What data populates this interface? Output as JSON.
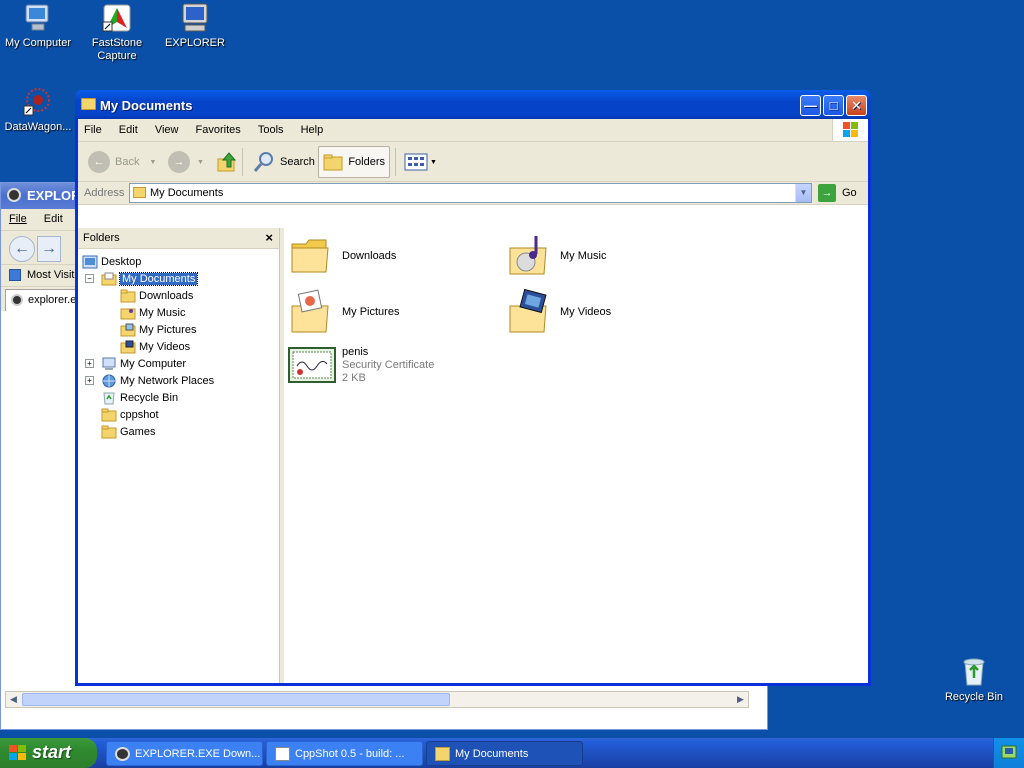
{
  "desktop": {
    "icons": [
      {
        "label": "My Computer"
      },
      {
        "label": "FastStone Capture"
      },
      {
        "label": "EXPLORER"
      },
      {
        "label": "DataWagon..."
      },
      {
        "label": "Recycle Bin"
      }
    ]
  },
  "ie_window": {
    "title": "EXPLORER",
    "menu": [
      "File",
      "Edit"
    ],
    "links_label": "Most Visite",
    "tab_label": "explorer.e"
  },
  "explorer": {
    "title": "My Documents",
    "menu": [
      "File",
      "Edit",
      "View",
      "Favorites",
      "Tools",
      "Help"
    ],
    "toolbar": {
      "back": "Back",
      "search": "Search",
      "folders": "Folders"
    },
    "address_label": "Address",
    "address_value": "My Documents",
    "go_label": "Go",
    "folders_pane": {
      "header": "Folders",
      "close": "×",
      "tree": [
        {
          "label": "Desktop"
        },
        {
          "label": "My Documents",
          "expander": "−"
        },
        {
          "label": "Downloads"
        },
        {
          "label": "My Music"
        },
        {
          "label": "My Pictures"
        },
        {
          "label": "My Videos"
        },
        {
          "label": "My Computer",
          "expander": "+"
        },
        {
          "label": "My Network Places",
          "expander": "+"
        },
        {
          "label": "Recycle Bin"
        },
        {
          "label": "cppshot"
        },
        {
          "label": "Games"
        }
      ]
    },
    "files": [
      {
        "name": "Downloads"
      },
      {
        "name": "My Music"
      },
      {
        "name": "My Pictures"
      },
      {
        "name": "My Videos"
      },
      {
        "name": "penis",
        "type": "Security Certificate",
        "size": "2 KB"
      }
    ]
  },
  "taskbar": {
    "start_label": "start",
    "tasks": [
      {
        "label": "EXPLORER.EXE Down..."
      },
      {
        "label": "CppShot 0.5 - build: ..."
      },
      {
        "label": "My Documents"
      }
    ]
  }
}
